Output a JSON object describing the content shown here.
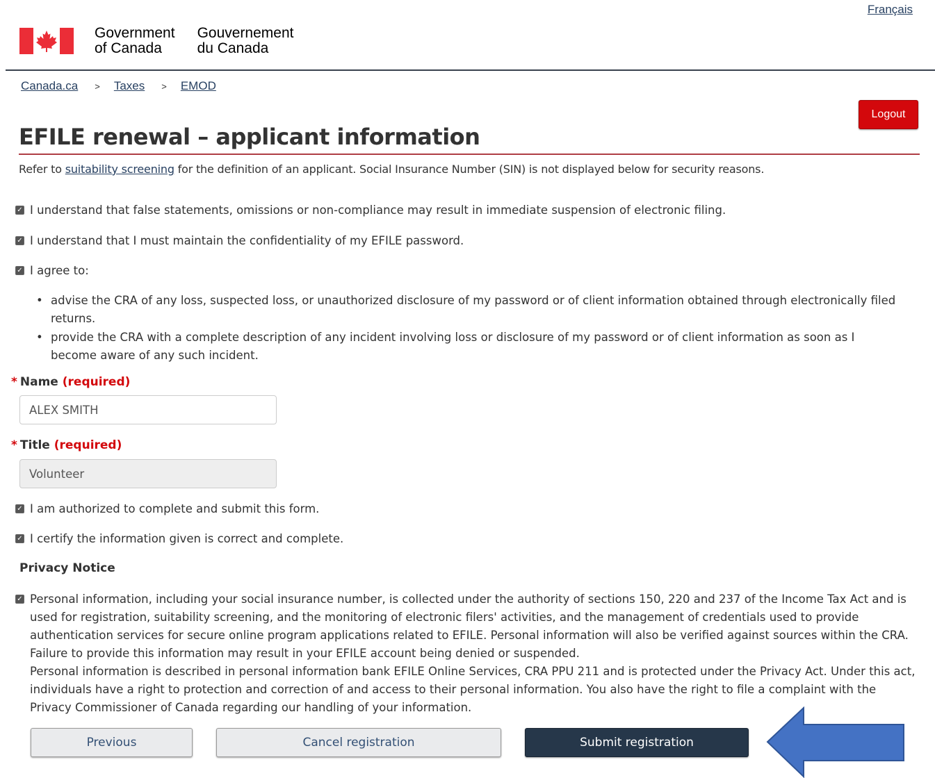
{
  "language_toggle": "Français",
  "gov_wordmark": {
    "english": "Government\nof Canada",
    "french": "Gouvernement\ndu Canada"
  },
  "breadcrumb": [
    "Canada.ca",
    "Taxes",
    "EMOD"
  ],
  "breadcrumb_separator": ">",
  "logout_label": "Logout",
  "page_title": "EFILE renewal – applicant information",
  "intro": {
    "before": "Refer to ",
    "link": "suitability screening",
    "after": " for the definition of an applicant. Social Insurance Number (SIN) is not displayed below for security reasons."
  },
  "acknowledgements": {
    "false_statements": "I understand that false statements, omissions or non-compliance may result in immediate suspension of electronic filing.",
    "confidentiality": "I understand that I must maintain the confidentiality of my EFILE password.",
    "agree": "I agree to:"
  },
  "agree_items": [
    "advise the CRA of any loss, suspected loss, or unauthorized disclosure of my password or of client information obtained through electronically filed returns.",
    "provide the CRA with a complete description of any incident involving loss or disclosure of my password or of client information as soon as I become aware of any such incident."
  ],
  "required_marker": "*",
  "required_text": "(required)",
  "name_field": {
    "label": "Name",
    "value": "ALEX SMITH"
  },
  "title_field": {
    "label": "Title",
    "value": "Volunteer"
  },
  "authorized": "I am authorized to complete and submit this form.",
  "certify": "I certify the information given is correct and complete.",
  "privacy": {
    "heading": "Privacy Notice",
    "paragraph1": "Personal information, including your social insurance number, is collected under the authority of sections 150, 220 and 237 of the Income Tax Act and is used for registration, suitability screening, and the monitoring of electronic filers' activities, and the management of credentials used to provide authentication services for secure online program applications related to EFILE. Personal information will also be verified against sources within the CRA. Failure to provide this information may result in your EFILE account being denied or suspended.",
    "paragraph2": "Personal information is described in personal information bank EFILE Online Services, CRA PPU 211 and is protected under the Privacy Act. Under this act, individuals have a right to protection and correction of and access to their personal information. You also have the right to file a complaint with the Privacy Commissioner of Canada regarding our handling of your information."
  },
  "buttons": {
    "previous": "Previous",
    "cancel": "Cancel registration",
    "submit": "Submit registration"
  },
  "checkbox_glyph": "✓",
  "colors": {
    "flag_red": "#eb2d37",
    "link": "#284162",
    "logout": "#d3080c",
    "title_rule": "#af3c43",
    "primary_button": "#26374a",
    "annotation_arrow": "#4472c4"
  },
  "icons": {
    "flag": "canada-flag-icon",
    "checkbox": "checkbox-checked-icon",
    "annotation": "arrow-left-icon"
  }
}
